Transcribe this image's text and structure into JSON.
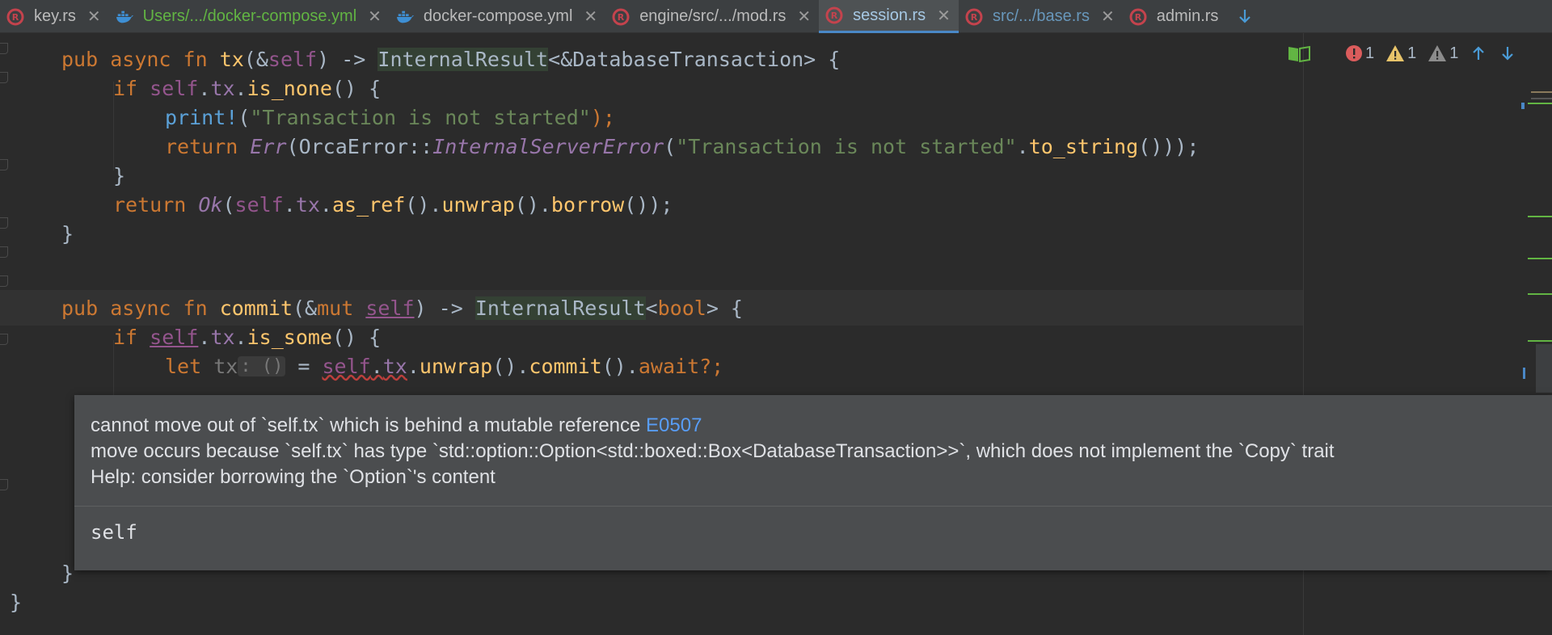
{
  "tabs": [
    {
      "label": "key.rs",
      "icon": "rust-icon",
      "state": "normal"
    },
    {
      "label": "Users/.../docker-compose.yml",
      "icon": "docker-icon",
      "state": "modified"
    },
    {
      "label": "docker-compose.yml",
      "icon": "docker-icon",
      "state": "normal"
    },
    {
      "label": "engine/src/.../mod.rs",
      "icon": "rust-icon",
      "state": "normal"
    },
    {
      "label": "session.rs",
      "icon": "rust-icon",
      "state": "active"
    },
    {
      "label": "src/.../base.rs",
      "icon": "rust-icon",
      "state": "vcs-changed"
    },
    {
      "label": "admin.rs",
      "icon": "rust-icon",
      "state": "normal"
    }
  ],
  "inspections": {
    "errors": "1",
    "warnings": "1",
    "weak_warnings": "1"
  },
  "code": {
    "l1": {
      "kw1": "pub ",
      "kw2": "async ",
      "kw3": "fn ",
      "name": "tx",
      "p1": "(&",
      "self": "self",
      "p2": ") -> ",
      "type": "InternalResult",
      "p3": "<&DatabaseTransaction> {"
    },
    "l2": {
      "kw": "if ",
      "self": "self",
      "dot1": ".",
      "field": "tx",
      "dot2": ".",
      "method": "is_none",
      "p": "() {"
    },
    "l3": {
      "macro": "print!",
      "p1": "(",
      "str": "\"Transaction is not started\"",
      "p2": ");"
    },
    "l4": {
      "kw": "return ",
      "err": "Err",
      "p1": "(OrcaError::",
      "variant": "InternalServerError",
      "p2": "(",
      "str": "\"Transaction is not started\"",
      "p3": ".",
      "method": "to_string",
      "p4": "()));"
    },
    "l5": {
      "text": "}"
    },
    "l6": {
      "kw": "return ",
      "ok": "Ok",
      "p1": "(",
      "self": "self",
      "dot1": ".",
      "field": "tx",
      "dot2": ".",
      "m1": "as_ref",
      "p2": "().",
      "m2": "unwrap",
      "p3": "().",
      "m3": "borrow",
      "p4": "());"
    },
    "l7": {
      "text": "}"
    },
    "l8": {
      "kw1": "pub ",
      "kw2": "async ",
      "kw3": "fn ",
      "name": "commit",
      "p1": "(&",
      "kw4": "mut ",
      "self": "self",
      "p2": ") -> ",
      "type": "InternalResult",
      "p3": "<",
      "kw5": "bool",
      "p4": "> {"
    },
    "l9": {
      "kw": "if ",
      "self": "self",
      "dot1": ".",
      "field": "tx",
      "dot2": ".",
      "method": "is_some",
      "p": "() {"
    },
    "l10": {
      "kw": "let ",
      "var": "tx",
      "hint": ": ()",
      "p1": " = ",
      "self": "self",
      "dot1": ".",
      "field": "tx",
      "dot2": ".",
      "m1": "unwrap",
      "p2": "().",
      "m2": "commit",
      "p3": "().",
      "kw2": "await",
      "p4": "?;"
    },
    "l11": {
      "text": "}"
    },
    "l12": {
      "text": "}"
    }
  },
  "popup": {
    "line1": "cannot move out of `self.tx` which is behind a mutable reference",
    "error_code": "E0507",
    "line2": "move occurs because `self.tx` has type `std::option::Option<std::boxed::Box<DatabaseTransaction>>`, which does not implement the `Copy` trait",
    "line3": "Help: consider borrowing the `Option`'s content",
    "quick": "self"
  },
  "colors": {
    "keyword": "#cc7832",
    "function": "#ffc66d",
    "string": "#6a8759",
    "self": "#94558d",
    "field": "#9876aa",
    "error": "#db5c5c",
    "warning": "#e8c46a",
    "accent": "#4a88c7"
  }
}
